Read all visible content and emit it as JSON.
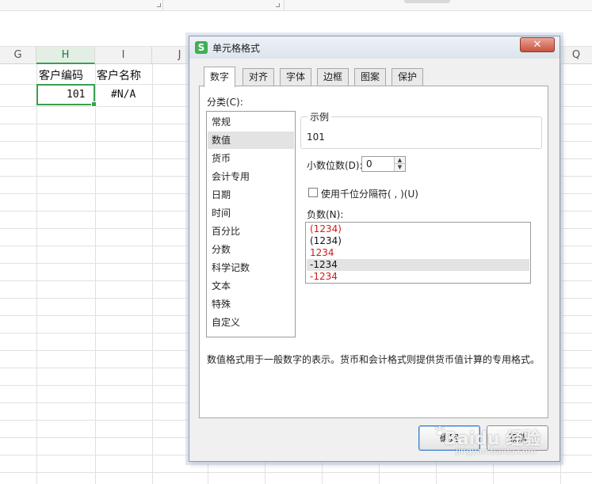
{
  "spreadsheet": {
    "columns": [
      {
        "key": "G",
        "label": "G",
        "active": false
      },
      {
        "key": "H",
        "label": "H",
        "active": true
      },
      {
        "key": "I",
        "label": "I",
        "active": false
      },
      {
        "key": "J",
        "label": "J",
        "active": false
      },
      {
        "key": "Q",
        "label": "Q",
        "active": false
      }
    ],
    "header_cells": {
      "h": "客户编码",
      "i": "客户名称"
    },
    "data_cells": {
      "h": "101",
      "i": "#N/A"
    }
  },
  "dialog": {
    "title": "单元格格式",
    "close_label": "✕",
    "tabs": [
      "数字",
      "对齐",
      "字体",
      "边框",
      "图案",
      "保护"
    ],
    "active_tab": "数字",
    "category_label": "分类(C):",
    "categories": [
      "常规",
      "数值",
      "货币",
      "会计专用",
      "日期",
      "时间",
      "百分比",
      "分数",
      "科学记数",
      "文本",
      "特殊",
      "自定义"
    ],
    "selected_category": "数值",
    "sample_label": "示例",
    "sample_value": "101",
    "decimal_label": "小数位数(D):",
    "decimal_value": "0",
    "thousands_label": "使用千位分隔符( , )(U)",
    "thousands_checked": false,
    "negative_label": "负数(N):",
    "negative_options": [
      {
        "text": "(1234)",
        "color": "#d11b1b"
      },
      {
        "text": "(1234)",
        "color": "#111111"
      },
      {
        "text": "1234",
        "color": "#d11b1b"
      },
      {
        "text": "-1234",
        "color": "#111111"
      },
      {
        "text": "-1234",
        "color": "#d11b1b"
      }
    ],
    "selected_negative_index": 3,
    "description": "数值格式用于一般数字的表示。货币和会计格式则提供货币值计算的专用格式。",
    "ok_label": "确定",
    "cancel_label": "取消"
  },
  "watermark": {
    "text": "Baidu 经验",
    "sub": "jingyan.baidu.com"
  },
  "colors": {
    "accent_green": "#3aa04f",
    "negative_red": "#d11b1b"
  }
}
